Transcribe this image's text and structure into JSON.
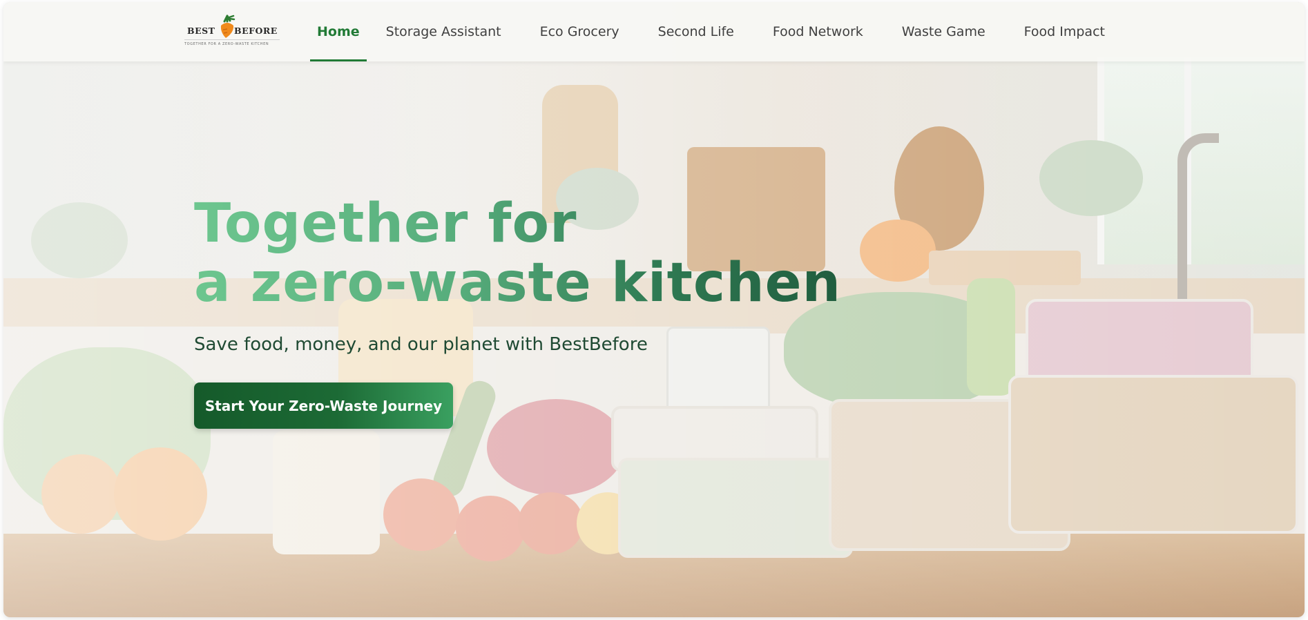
{
  "brand": {
    "name_left": "BEST",
    "name_right": "BEFORE",
    "tagline": "TOGETHER FOR A ZERO-WASTE KITCHEN",
    "logo_icon": "carrot-icon"
  },
  "nav": {
    "items": [
      {
        "label": "Home",
        "active": true
      },
      {
        "label": "Storage Assistant",
        "active": false
      },
      {
        "label": "Eco Grocery",
        "active": false
      },
      {
        "label": "Second Life",
        "active": false
      },
      {
        "label": "Food Network",
        "active": false
      },
      {
        "label": "Waste Game",
        "active": false
      },
      {
        "label": "Food Impact",
        "active": false
      }
    ]
  },
  "hero": {
    "title_line1": "Together for",
    "title_line2": "a zero-waste kitchen",
    "subtitle": "Save food, money, and our planet with BestBefore",
    "cta_label": "Start Your Zero-Waste Journey"
  },
  "colors": {
    "accent": "#217a35",
    "cta_dark": "#155a2a",
    "cta_light": "#3aa060",
    "title_light": "#6dc68f",
    "title_dark": "#1f5a3c"
  }
}
